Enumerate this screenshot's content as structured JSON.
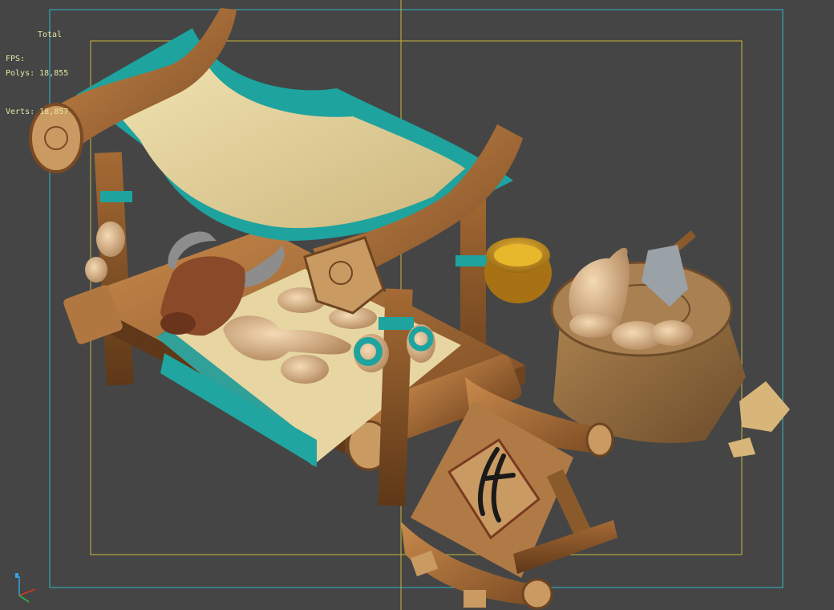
{
  "viewport": {
    "stats": {
      "total_label": "Total",
      "polys": "Polys: 18,855",
      "verts": "Verts: 18,857",
      "fps": "FPS:"
    },
    "colors": {
      "background": "#454545",
      "safe_frame_outer": "#33b8c8",
      "safe_frame_inner": "#c8b840",
      "stats_text": "#e6e6a8"
    }
  }
}
